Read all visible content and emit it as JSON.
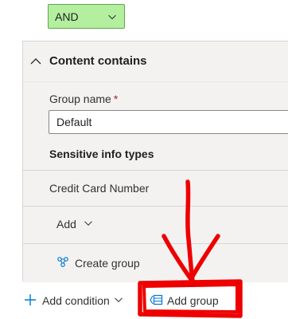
{
  "operator_select": {
    "value": "AND",
    "icon": "chevron-down-icon"
  },
  "panel": {
    "title": "Content contains",
    "collapse_icon": "chevron-up-icon",
    "group_name_label": "Group name",
    "required_marker": "*",
    "group_name_value": "Default",
    "sensitive_info_types_heading": "Sensitive info types",
    "items": [
      {
        "label": "Credit Card Number"
      }
    ],
    "add_label": "Add",
    "create_group_label": "Create group"
  },
  "footer": {
    "add_condition_label": "Add condition",
    "add_group_label": "Add group"
  },
  "colors": {
    "operator_bg": "#b3ef9f",
    "operator_border": "#5fa849",
    "panel_bg": "#f3f2f1",
    "accent_blue": "#0078d4",
    "annotation_red": "#ee0000"
  }
}
